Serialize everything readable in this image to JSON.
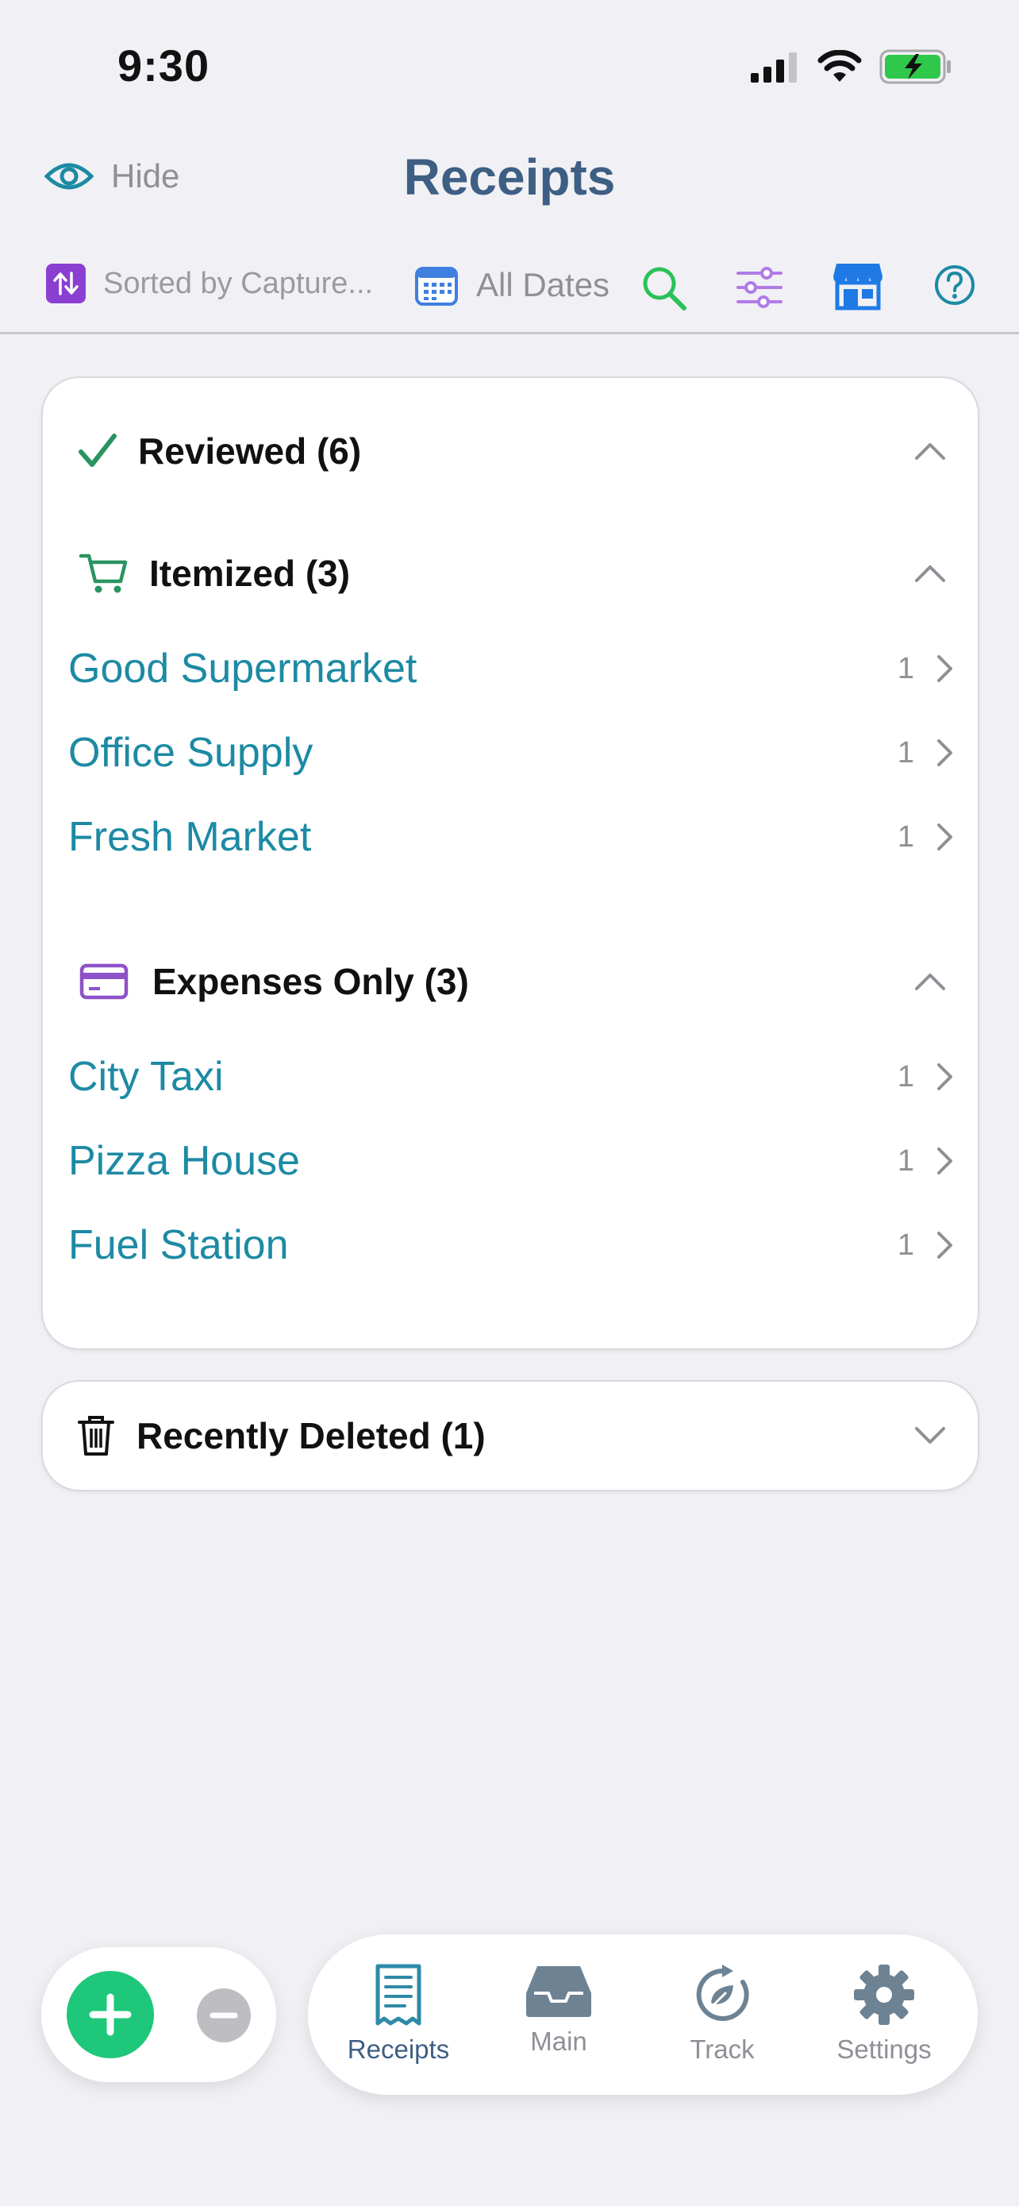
{
  "status_bar": {
    "time": "9:30"
  },
  "header": {
    "hide_label": "Hide",
    "title": "Receipts"
  },
  "toolbar": {
    "sort_label": "Sorted by Capture...",
    "dates_label": "All Dates"
  },
  "reviewed": {
    "label": "Reviewed (6)",
    "itemized": {
      "label": "Itemized (3)",
      "items": [
        {
          "name": "Good Supermarket",
          "count": "1"
        },
        {
          "name": "Office Supply",
          "count": "1"
        },
        {
          "name": "Fresh Market",
          "count": "1"
        }
      ]
    },
    "expenses": {
      "label": "Expenses Only (3)",
      "items": [
        {
          "name": "City Taxi",
          "count": "1"
        },
        {
          "name": "Pizza House",
          "count": "1"
        },
        {
          "name": "Fuel Station",
          "count": "1"
        }
      ]
    }
  },
  "recently_deleted": {
    "label": "Recently Deleted (1)"
  },
  "tabs": [
    {
      "label": "Receipts",
      "icon": "receipt-icon"
    },
    {
      "label": "Main",
      "icon": "inbox-icon"
    },
    {
      "label": "Track",
      "icon": "track-icon"
    },
    {
      "label": "Settings",
      "icon": "gear-icon"
    }
  ],
  "colors": {
    "accent": "#1d8aa4",
    "title": "#3e5f84",
    "add_button": "#1ec77a",
    "sort_badge": "#8b3fd1"
  }
}
